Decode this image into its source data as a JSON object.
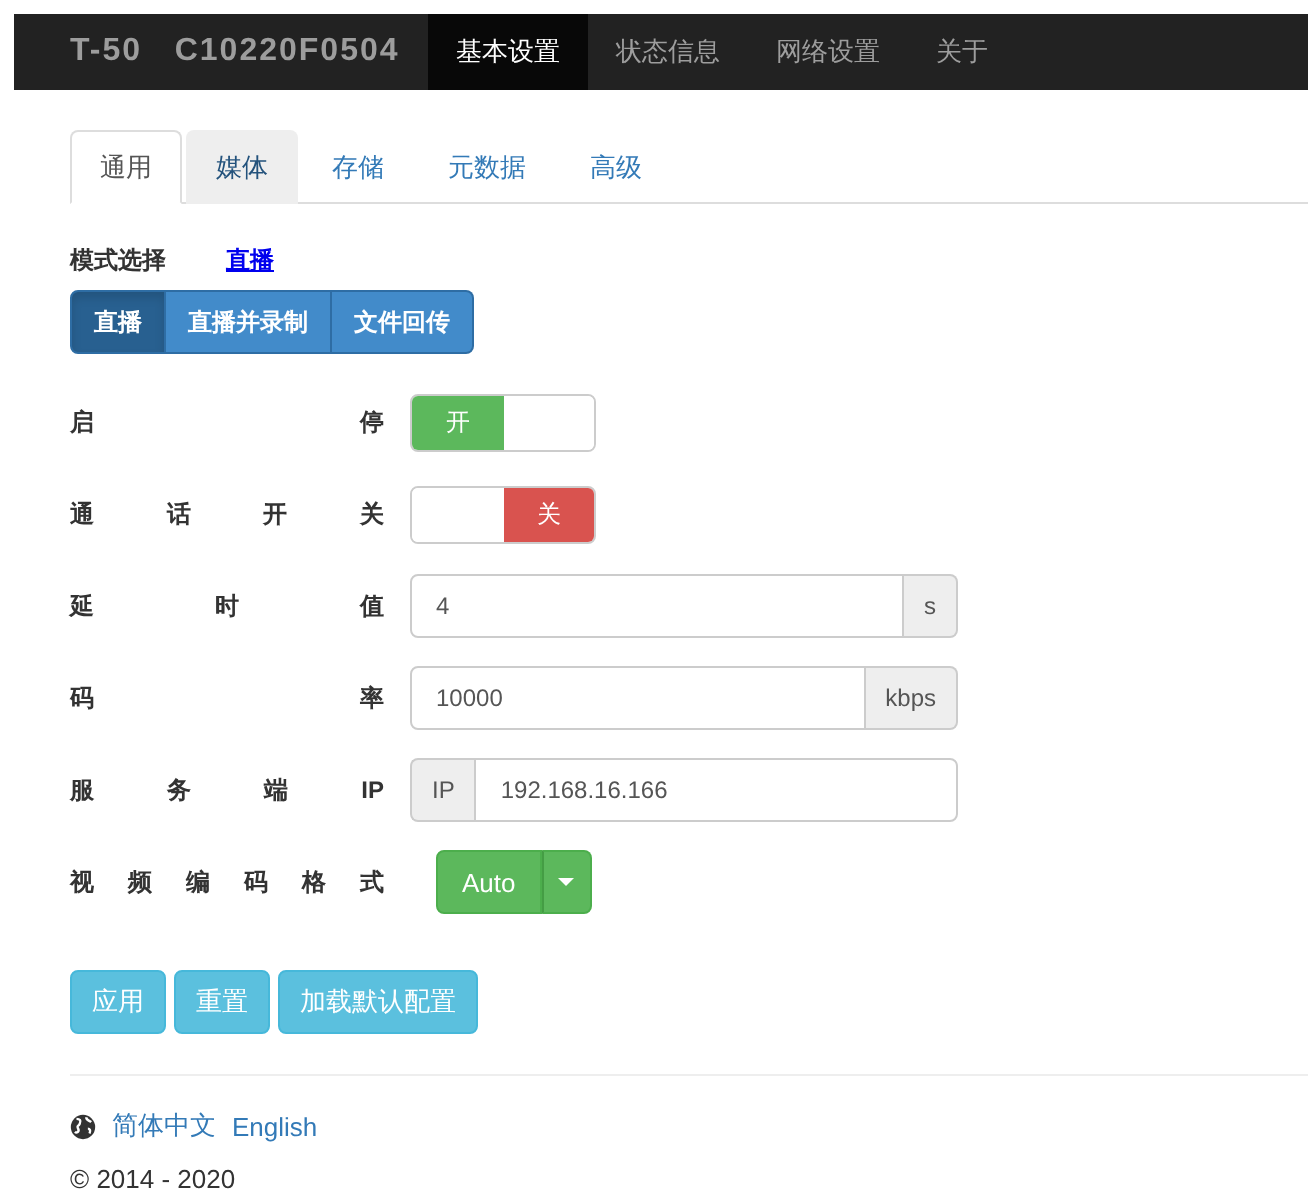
{
  "navbar": {
    "brand": "T-50   C10220F0504",
    "items": [
      {
        "label": "基本设置",
        "selected": true
      },
      {
        "label": "状态信息",
        "selected": false
      },
      {
        "label": "网络设置",
        "selected": false
      },
      {
        "label": "关于",
        "selected": false
      }
    ]
  },
  "tabs": [
    {
      "label": "通用",
      "selected": true,
      "highlighted": false
    },
    {
      "label": "媒体",
      "selected": false,
      "highlighted": true
    },
    {
      "label": "存储",
      "selected": false,
      "highlighted": false
    },
    {
      "label": "元数据",
      "selected": false,
      "highlighted": false
    },
    {
      "label": "高级",
      "selected": false,
      "highlighted": false
    }
  ],
  "mode": {
    "label": "模式选择",
    "value": "直播",
    "options": [
      {
        "label": "直播",
        "selected": true
      },
      {
        "label": "直播并录制",
        "selected": false
      },
      {
        "label": "文件回传",
        "selected": false
      }
    ]
  },
  "fields": [
    {
      "kind": "toggle",
      "label": "启停",
      "on": true,
      "text": "开"
    },
    {
      "kind": "toggle",
      "label": "通话开关",
      "on": false,
      "text": "关"
    },
    {
      "kind": "input",
      "label": "延时值",
      "value": "4",
      "suffix": "s"
    },
    {
      "kind": "input",
      "label": "码率",
      "value": "10000",
      "suffix": "kbps"
    },
    {
      "kind": "input",
      "label": "服务端IP",
      "value": "192.168.16.166",
      "prefix": "IP"
    },
    {
      "kind": "select",
      "label": "视频编码格式",
      "value": "Auto"
    }
  ],
  "buttons": [
    "应用",
    "重置",
    "加载默认配置"
  ],
  "footer": {
    "languages": [
      "简体中文",
      "English"
    ],
    "copyright": "© 2014 - 2020"
  }
}
